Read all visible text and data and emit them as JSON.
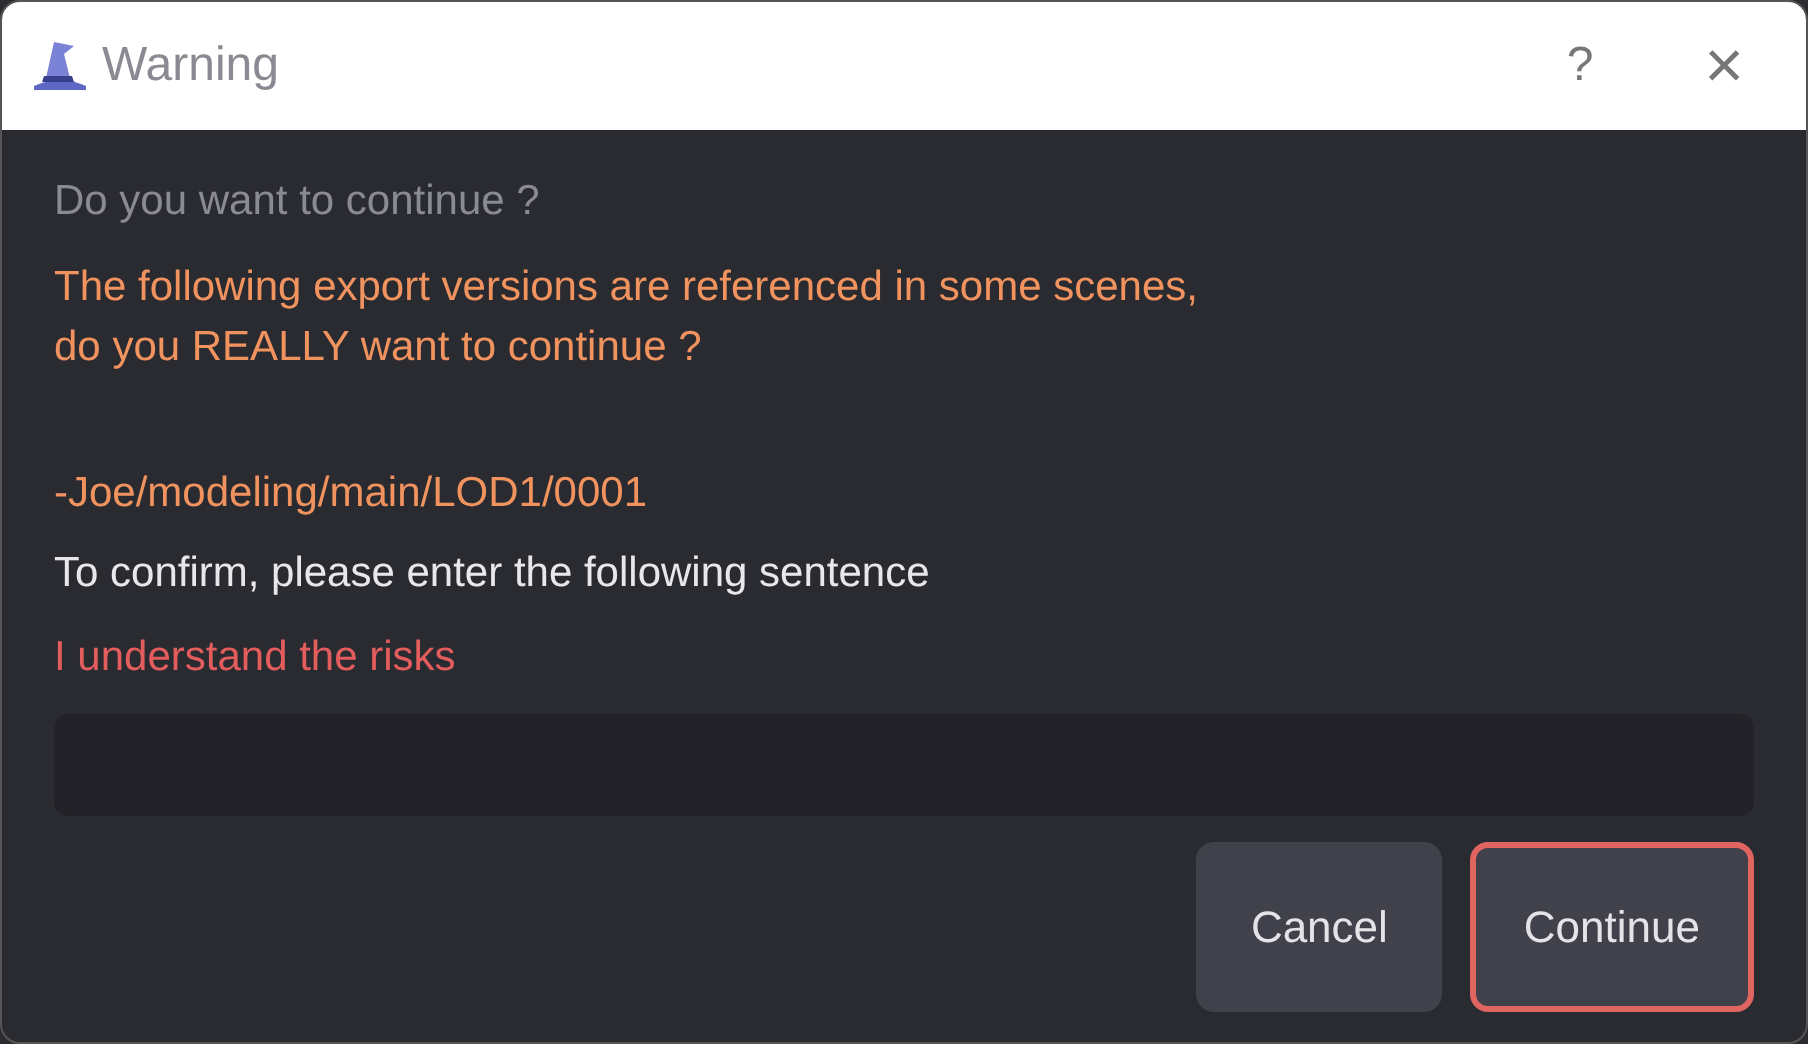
{
  "window": {
    "title": "Warning",
    "help": "?",
    "close": "×"
  },
  "question": "Do you want to continue ?",
  "warning_lines": [
    "The following export versions are referenced in some scenes,",
    "do you REALLY want to continue ?"
  ],
  "versions": [
    "-Joe/modeling/main/LOD1/0001"
  ],
  "instruction": "To confirm, please enter the following sentence",
  "confirm_sentence": "I understand the risks",
  "buttons": [
    {
      "label": "Cancel",
      "focused": false
    },
    {
      "label": "Continue",
      "focused": true
    }
  ]
}
